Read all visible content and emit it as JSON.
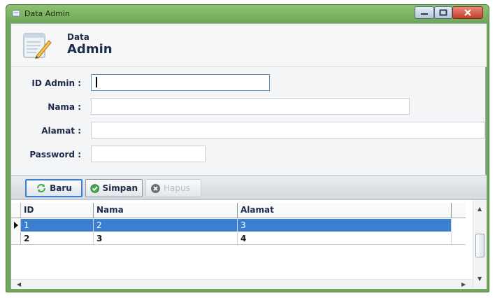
{
  "window": {
    "title": "Data Admin"
  },
  "header": {
    "line1": "Data",
    "line2": "Admin"
  },
  "form": {
    "id_label": "ID Admin :",
    "nama_label": "Nama :",
    "alamat_label": "Alamat :",
    "password_label": "Password :",
    "id_value": "",
    "nama_value": "",
    "alamat_value": "",
    "password_value": ""
  },
  "toolbar": {
    "baru": "Baru",
    "simpan": "Simpan",
    "hapus": "Hapus"
  },
  "grid": {
    "columns": [
      "ID",
      "Nama",
      "Alamat"
    ],
    "rows": [
      [
        "1",
        "2",
        "3"
      ],
      [
        "2",
        "3",
        "4"
      ]
    ],
    "selected_row": 0
  },
  "colors": {
    "title_bar": "#6da656",
    "selection": "#3a7fd0",
    "active_border": "#3b7fd4"
  },
  "icons": [
    "app-icon",
    "minimize-icon",
    "maximize-icon",
    "close-icon",
    "document-icon",
    "new-icon",
    "save-icon",
    "delete-icon",
    "row-indicator-icon"
  ]
}
